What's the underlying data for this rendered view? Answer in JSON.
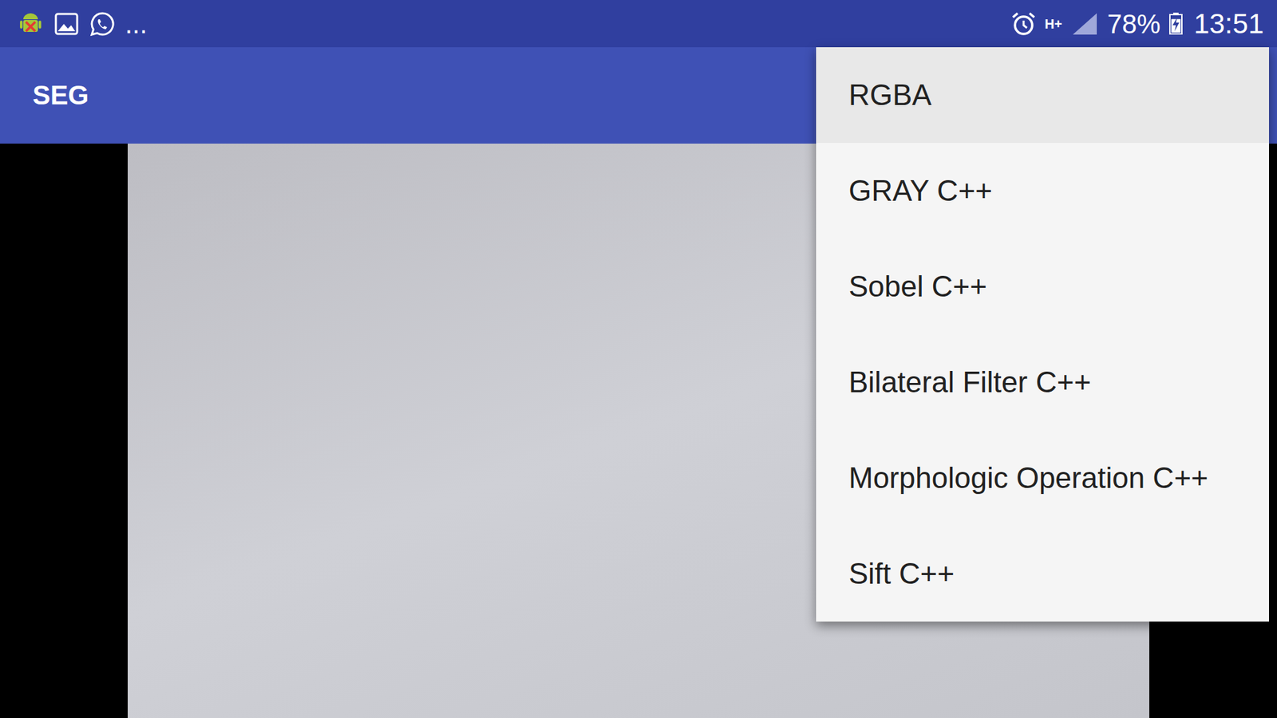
{
  "status_bar": {
    "more": "...",
    "network": "H+",
    "battery_text": "78%",
    "time": "13:51",
    "battery": {
      "level": 0.78,
      "charging": true
    }
  },
  "app_bar": {
    "title": "SEG"
  },
  "menu": {
    "items": [
      {
        "label": "RGBA",
        "selected": true
      },
      {
        "label": "GRAY C++",
        "selected": false
      },
      {
        "label": "Sobel C++",
        "selected": false
      },
      {
        "label": "Bilateral Filter C++",
        "selected": false
      },
      {
        "label": "Morphologic Operation C++",
        "selected": false
      },
      {
        "label": "Sift C++",
        "selected": false
      }
    ]
  }
}
